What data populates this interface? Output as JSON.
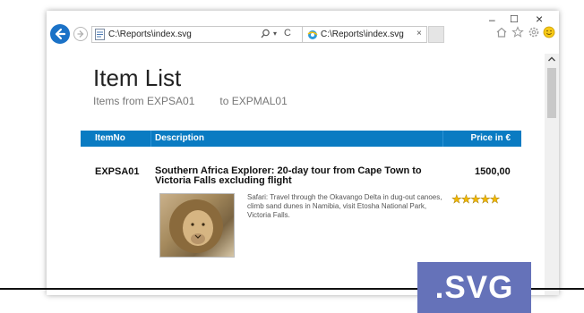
{
  "browser": {
    "address": "C:\\Reports\\index.svg",
    "tab_title": "C:\\Reports\\index.svg",
    "tab_close": "×",
    "window_controls": {
      "minimize": "–",
      "maximize": "☐",
      "close": "×"
    },
    "refresh": "C",
    "dropdown": "▾",
    "icons": [
      "back-icon",
      "forward-icon",
      "page-icon",
      "search-icon",
      "refresh-icon",
      "ie-icon",
      "home-icon",
      "star-icon",
      "gear-icon",
      "smiley-icon"
    ]
  },
  "page": {
    "title": "Item List",
    "range_from": "Items from EXPSA01",
    "range_to": "to EXPMAL01",
    "table": {
      "headers": [
        "ItemNo",
        "Description",
        "Price in €"
      ],
      "rows": [
        {
          "item_no": "EXPSA01",
          "description": "Southern Africa Explorer: 20-day tour from Cape Town to Victoria Falls excluding flight",
          "price": "1500,00",
          "detail": "Safari: Travel through the Okavango Delta in dug-out canoes, climb sand dunes in Namibia, visit Etosha National Park, Victoria Falls.",
          "rating": "★★★★★"
        }
      ]
    }
  },
  "badge": {
    "label": ".SVG"
  },
  "colors": {
    "accent": "#0a7bc2",
    "badge": "#6572b9",
    "star": "#f2b800"
  }
}
